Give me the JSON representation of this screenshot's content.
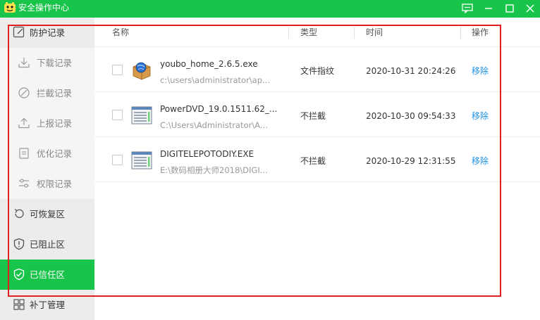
{
  "window": {
    "title": "安全操作中心"
  },
  "sidebar": {
    "items": [
      {
        "label": "防护记录",
        "icon": "edit-note-icon"
      },
      {
        "label": "下载记录",
        "icon": "download-icon"
      },
      {
        "label": "拦截记录",
        "icon": "block-icon"
      },
      {
        "label": "上报记录",
        "icon": "upload-icon"
      },
      {
        "label": "优化记录",
        "icon": "document-icon"
      },
      {
        "label": "权限记录",
        "icon": "permission-icon"
      },
      {
        "label": "可恢复区",
        "icon": "restore-icon"
      },
      {
        "label": "已阻止区",
        "icon": "shield-alert-icon"
      },
      {
        "label": "已信任区",
        "icon": "shield-check-icon"
      },
      {
        "label": "补丁管理",
        "icon": "grid-icon"
      }
    ]
  },
  "table": {
    "columns": {
      "name": "名称",
      "type": "类型",
      "time": "时间",
      "action": "操作"
    },
    "rows": [
      {
        "name": "youbo_home_2.6.5.exe",
        "path": "c:\\users\\administrator\\ap...",
        "type": "文件指纹",
        "time": "2020-10-31 20:24:26",
        "action": "移除",
        "icon": "installer-box-icon"
      },
      {
        "name": "PowerDVD_19.0.1511.62_...",
        "path": "C:\\Users\\Administrator\\A...",
        "type": "不拦截",
        "time": "2020-10-30 09:54:33",
        "action": "移除",
        "icon": "exe-window-icon"
      },
      {
        "name": "DIGITELEPOTODIY.EXE",
        "path": "E:\\数码相册大师2018\\DIGI...",
        "type": "不拦截",
        "time": "2020-10-29 12:31:55",
        "action": "移除",
        "icon": "exe-window-icon"
      }
    ]
  },
  "colors": {
    "accent": "#19c44a",
    "link": "#1e90e6",
    "highlight_frame": "#e02020"
  }
}
